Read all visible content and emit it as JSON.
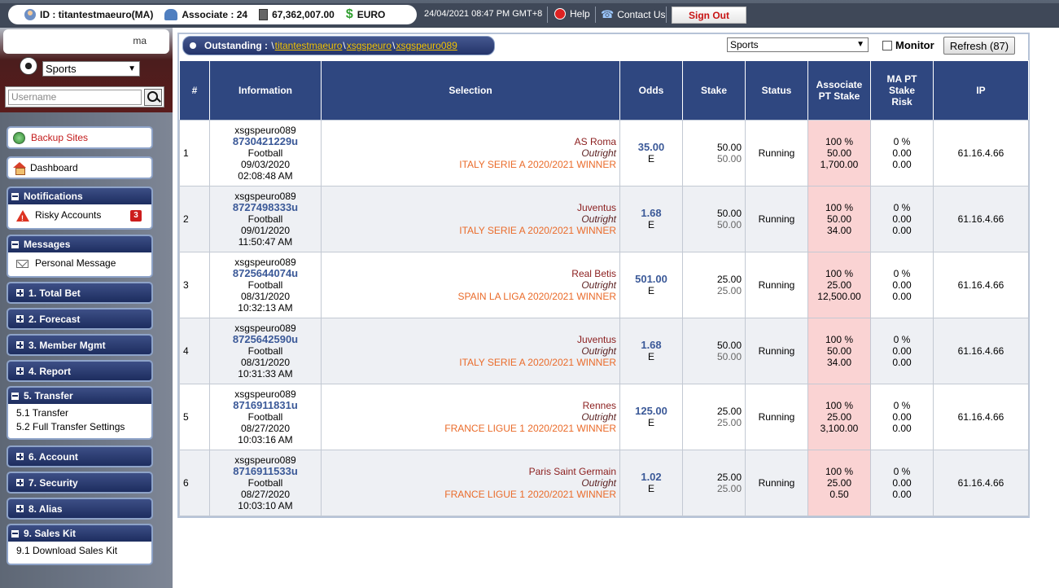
{
  "topbar": {
    "id_text": "ID : titantestmaeuro(MA)",
    "associate_text": "Associate : 24",
    "balance": "67,362,007.00",
    "currency": "EURO",
    "datetime": "24/04/2021 08:47 PM GMT+8",
    "help": "Help",
    "contact": "Contact Us",
    "signout": "Sign Out"
  },
  "sidebar": {
    "ma_label": "ma",
    "sport_select": "Sports",
    "username_placeholder": "Username",
    "backup_sites": "Backup Sites",
    "dashboard": "Dashboard",
    "notifications": {
      "title": "Notifications",
      "risky_accounts": "Risky Accounts",
      "risky_count": "3"
    },
    "messages": {
      "title": "Messages",
      "personal_message": "Personal Message"
    },
    "menu": [
      {
        "label": "1. Total Bet"
      },
      {
        "label": "2. Forecast"
      },
      {
        "label": "3. Member Mgmt"
      },
      {
        "label": "4. Report"
      },
      {
        "label": "5. Transfer",
        "items": [
          "5.1 Transfer",
          "5.2 Full Transfer Settings"
        ]
      },
      {
        "label": "6. Account"
      },
      {
        "label": "7. Security"
      },
      {
        "label": "8. Alias"
      },
      {
        "label": "9. Sales Kit",
        "items": [
          "9.1 Download Sales Kit"
        ]
      }
    ]
  },
  "main": {
    "outstanding_label": "Outstanding :",
    "crumbs": [
      "titantestmaeuro",
      "xsgspeuro",
      "xsgspeuro089"
    ],
    "sport_select": "Sports",
    "monitor_label": "Monitor",
    "refresh_label": "Refresh (87)",
    "columns": [
      "#",
      "Information",
      "Selection",
      "Odds",
      "Stake",
      "Status",
      "Associate PT Stake",
      "MA PT Stake Risk",
      "IP"
    ],
    "rows": [
      {
        "num": "1",
        "user": "xsgspeuro089",
        "bet_id": "8730421229u",
        "sport": "Football",
        "date": "09/03/2020",
        "time": "02:08:48 AM",
        "team": "AS Roma",
        "market": "Outright",
        "league": "ITALY SERIE A 2020/2021 WINNER",
        "odds": "35.00",
        "odds_type": "E",
        "stake": "50.00",
        "stake2": "50.00",
        "status": "Running",
        "assoc_pct": "100 %",
        "assoc_stake": "50.00",
        "assoc_risk": "1,700.00",
        "ma_pct": "0 %",
        "ma_stake": "0.00",
        "ma_risk": "0.00",
        "ip": "61.16.4.66"
      },
      {
        "num": "2",
        "user": "xsgspeuro089",
        "bet_id": "8727498333u",
        "sport": "Football",
        "date": "09/01/2020",
        "time": "11:50:47 AM",
        "team": "Juventus",
        "market": "Outright",
        "league": "ITALY SERIE A 2020/2021 WINNER",
        "odds": "1.68",
        "odds_type": "E",
        "stake": "50.00",
        "stake2": "50.00",
        "status": "Running",
        "assoc_pct": "100 %",
        "assoc_stake": "50.00",
        "assoc_risk": "34.00",
        "ma_pct": "0 %",
        "ma_stake": "0.00",
        "ma_risk": "0.00",
        "ip": "61.16.4.66"
      },
      {
        "num": "3",
        "user": "xsgspeuro089",
        "bet_id": "8725644074u",
        "sport": "Football",
        "date": "08/31/2020",
        "time": "10:32:13 AM",
        "team": "Real Betis",
        "market": "Outright",
        "league": "SPAIN LA LIGA 2020/2021 WINNER",
        "odds": "501.00",
        "odds_type": "E",
        "stake": "25.00",
        "stake2": "25.00",
        "status": "Running",
        "assoc_pct": "100 %",
        "assoc_stake": "25.00",
        "assoc_risk": "12,500.00",
        "ma_pct": "0 %",
        "ma_stake": "0.00",
        "ma_risk": "0.00",
        "ip": "61.16.4.66"
      },
      {
        "num": "4",
        "user": "xsgspeuro089",
        "bet_id": "8725642590u",
        "sport": "Football",
        "date": "08/31/2020",
        "time": "10:31:33 AM",
        "team": "Juventus",
        "market": "Outright",
        "league": "ITALY SERIE A 2020/2021 WINNER",
        "odds": "1.68",
        "odds_type": "E",
        "stake": "50.00",
        "stake2": "50.00",
        "status": "Running",
        "assoc_pct": "100 %",
        "assoc_stake": "50.00",
        "assoc_risk": "34.00",
        "ma_pct": "0 %",
        "ma_stake": "0.00",
        "ma_risk": "0.00",
        "ip": "61.16.4.66"
      },
      {
        "num": "5",
        "user": "xsgspeuro089",
        "bet_id": "8716911831u",
        "sport": "Football",
        "date": "08/27/2020",
        "time": "10:03:16 AM",
        "team": "Rennes",
        "market": "Outright",
        "league": "FRANCE LIGUE 1 2020/2021 WINNER",
        "odds": "125.00",
        "odds_type": "E",
        "stake": "25.00",
        "stake2": "25.00",
        "status": "Running",
        "assoc_pct": "100 %",
        "assoc_stake": "25.00",
        "assoc_risk": "3,100.00",
        "ma_pct": "0 %",
        "ma_stake": "0.00",
        "ma_risk": "0.00",
        "ip": "61.16.4.66"
      },
      {
        "num": "6",
        "user": "xsgspeuro089",
        "bet_id": "8716911533u",
        "sport": "Football",
        "date": "08/27/2020",
        "time": "10:03:10 AM",
        "team": "Paris Saint Germain",
        "market": "Outright",
        "league": "FRANCE LIGUE 1 2020/2021 WINNER",
        "odds": "1.02",
        "odds_type": "E",
        "stake": "25.00",
        "stake2": "25.00",
        "status": "Running",
        "assoc_pct": "100 %",
        "assoc_stake": "25.00",
        "assoc_risk": "0.50",
        "ma_pct": "0 %",
        "ma_stake": "0.00",
        "ma_risk": "0.00",
        "ip": "61.16.4.66"
      }
    ]
  },
  "colors": {
    "header_navy": "#2f4780",
    "assoc_pink": "#fad3d3",
    "league_orange": "#ea6b2a",
    "id_blue": "#3b5998",
    "signout_red": "#c81414"
  }
}
